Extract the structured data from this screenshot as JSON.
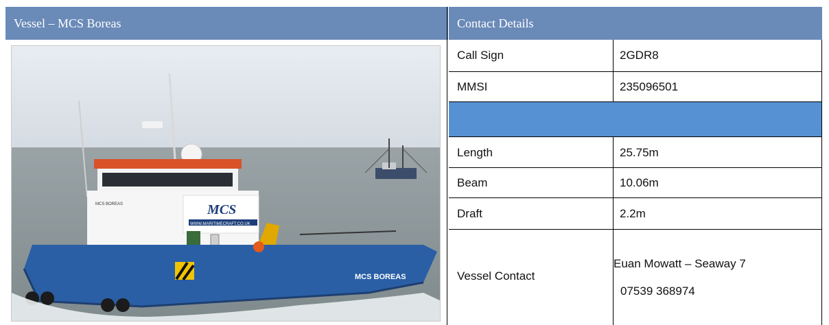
{
  "vessel_header": "Vessel – MCS Boreas",
  "contact_header": "Contact Details",
  "photo": {
    "boat_name": "MCS BOREAS",
    "hull_text": "MCS BOREAS",
    "logo_text": "MCS",
    "banner": "WWW.MARITIMECRAFT.CO.UK"
  },
  "details": [
    {
      "label": "Call Sign",
      "value": "2GDR8"
    },
    {
      "label": "MMSI",
      "value": "235096501"
    },
    {
      "label": "Length",
      "value": "25.75m"
    },
    {
      "label": "Beam",
      "value": "10.06m"
    },
    {
      "label": "Draft",
      "value": "2.2m"
    }
  ],
  "contact": {
    "label": "Vessel Contact",
    "name_line": "Euan Mowatt – Seaway 7",
    "phone": "07539 368974"
  },
  "colors": {
    "header_bg": "#6a8ab8",
    "separator_row": "#5691d3",
    "hull": "#2a5fa6"
  }
}
